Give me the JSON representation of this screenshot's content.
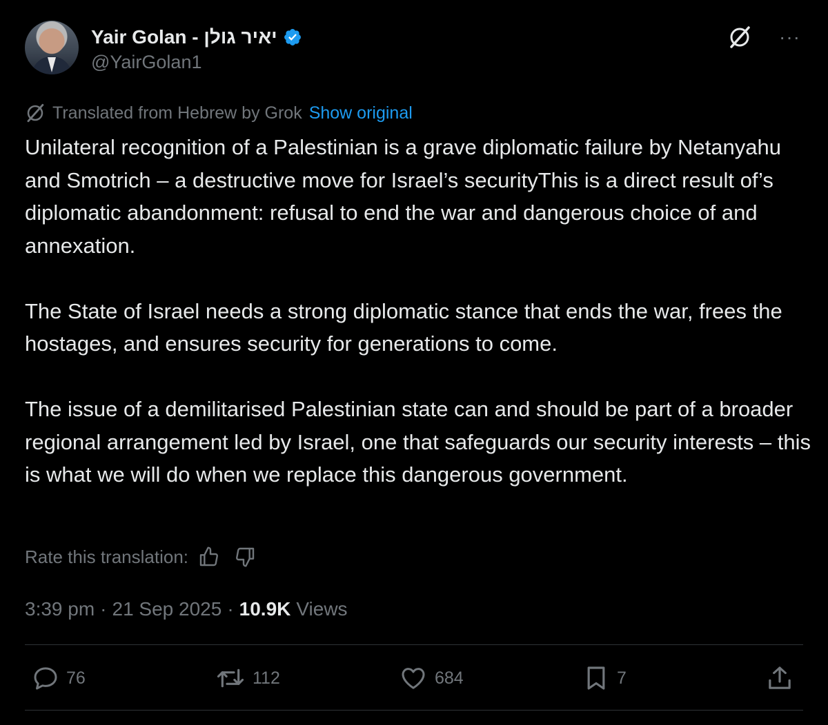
{
  "author": {
    "display_name": "Yair Golan - יאיר גולן",
    "handle": "@YairGolan1",
    "verified": true
  },
  "translation": {
    "label": "Translated from Hebrew by Grok",
    "show_original": "Show original",
    "rate_label": "Rate this translation:"
  },
  "post": {
    "text": " Unilateral recognition of a Palestinian is a grave diplomatic failure by Netanyahu and Smotrich – a destructive move for Israel’s securityThis is a direct result of’s diplomatic abandonment: refusal to end the war and dangerous choice of and annexation.\n\nThe State of Israel needs a strong diplomatic stance that ends the war, frees the hostages, and ensures security for generations to come.\n\nThe issue of a demilitarised Palestinian state can and should be part of a broader regional arrangement led by Israel, one that safeguards our security interests – this is what we will do when we replace this dangerous government."
  },
  "meta": {
    "time": "3:39 pm",
    "separator": "·",
    "date": "21 Sep 2025",
    "views_count": "10.9K",
    "views_label": "Views"
  },
  "actions": {
    "replies": "76",
    "reposts": "112",
    "likes": "684",
    "bookmarks": "7"
  },
  "icons": [
    "grok-icon",
    "more-icon",
    "verified-badge-icon",
    "thumbs-up-icon",
    "thumbs-down-icon",
    "reply-icon",
    "repost-icon",
    "like-icon",
    "bookmark-icon",
    "share-icon"
  ],
  "colors": {
    "background": "#000000",
    "text": "#e7e9ea",
    "secondary": "#71767b",
    "link": "#1d9bf0",
    "divider": "#2f3336"
  }
}
